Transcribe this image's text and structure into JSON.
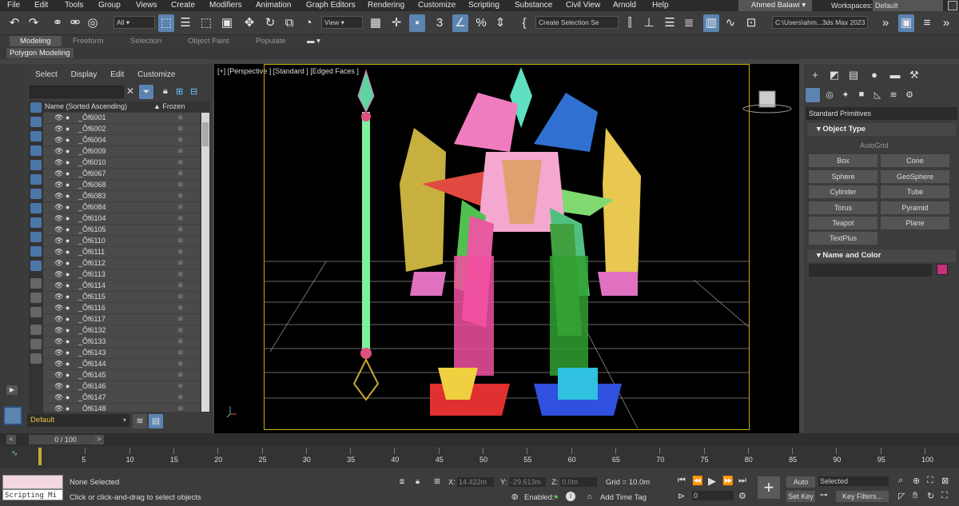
{
  "menu": [
    "File",
    "Edit",
    "Tools",
    "Group",
    "Views",
    "Create",
    "Modifiers",
    "Animation",
    "Graph Editors",
    "Rendering",
    "Customize",
    "Scripting",
    "Substance",
    "Civil View",
    "Arnold",
    "Help"
  ],
  "user": "Ahmed Balawi",
  "workspace_label": "Workspaces:",
  "workspace_value": "Default",
  "toolbar": {
    "filter_value": "All",
    "view_value": "View",
    "selection_set": "Create Selection Se",
    "path": "C:\\Users\\ahm...3ds Max 2023"
  },
  "ribbon_tabs": [
    "Modeling",
    "Freeform",
    "Selection",
    "Object Paint",
    "Populate"
  ],
  "sub_ribbon": "Polygon Modeling",
  "explorer": {
    "menu": [
      "Select",
      "Display",
      "Edit",
      "Customize"
    ],
    "col_name": "Name (Sorted Ascending)",
    "col_frozen": "▲ Frozen",
    "rows": [
      "_Ôf6001",
      "_Ôf6002",
      "_Ôf6004",
      "_Ôf6009",
      "_Ôf6010",
      "_Ôf6067",
      "_Ôf6068",
      "_Ôf6083",
      "_Ôf6084",
      "_Ôf6104",
      "_Ôf6105",
      "_Ôf6110",
      "_Ôf6111",
      "_Ôf6112",
      "_Ôf6113",
      "_Ôf6114",
      "_Ôf6115",
      "_Ôf6116",
      "_Ôf6117",
      "_Ôf6132",
      "_Ôf6133",
      "_Ôf6143",
      "_Ôf6144",
      "_Ôf6145",
      "_Ôf6146",
      "_Ôf6147",
      "_Ôf6148"
    ],
    "layer": "Default"
  },
  "viewport": {
    "label": "[+] [Perspective ] [Standard ] [Edged Faces ]"
  },
  "command_panel": {
    "dropdown": "Standard Primitives",
    "rollout_object_type": "Object Type",
    "autogrid": "AutoGrid",
    "primitives": [
      "Box",
      "Cone",
      "Sphere",
      "GeoSphere",
      "Cylinder",
      "Tube",
      "Torus",
      "Pyramid",
      "Teapot",
      "Plane",
      "TextPlus"
    ],
    "rollout_name_color": "Name and Color",
    "object_color": "#c8307a"
  },
  "timeline": {
    "frame_label": "0 / 100",
    "ticks": [
      "5",
      "10",
      "15",
      "20",
      "25",
      "30",
      "35",
      "40",
      "45",
      "50",
      "55",
      "60",
      "65",
      "70",
      "75",
      "80",
      "85",
      "90",
      "95",
      "100"
    ]
  },
  "status": {
    "maxscript": "Scripting Mi",
    "selection": "None Selected",
    "prompt": "Click or click-and-drag to select objects",
    "x_label": "X:",
    "x_value": "14.422m",
    "y_label": "Y:",
    "y_value": "-29.613m",
    "z_label": "Z:",
    "z_value": "0.0m",
    "grid": "Grid = 10.0m",
    "enabled": "Enabled:",
    "add_time_tag": "Add Time Tag",
    "auto_key": "Auto Key",
    "set_key": "Set Key",
    "selected": "Selected",
    "key_filters": "Key Filters...",
    "frame_value": "0"
  }
}
